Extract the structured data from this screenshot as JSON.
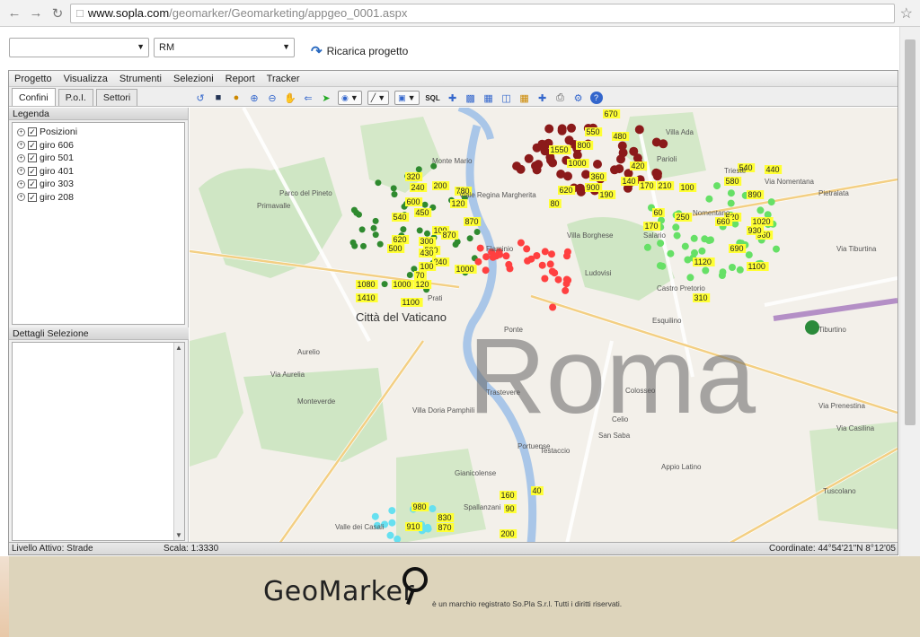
{
  "browser": {
    "url_host": "www.sopla.com",
    "url_path": "/geomarker/Geomarketing/appgeo_0001.aspx"
  },
  "controls": {
    "select1_value": "",
    "select2_value": "RM",
    "reload_label": "Ricarica progetto"
  },
  "menu": [
    "Progetto",
    "Visualizza",
    "Strumenti",
    "Selezioni",
    "Report",
    "Tracker"
  ],
  "tabs": [
    "Confini",
    "P.o.I.",
    "Settori"
  ],
  "toolbar": {
    "sql_label": "SQL"
  },
  "legend": {
    "title": "Legenda",
    "items": [
      "Posizioni",
      "giro 606",
      "giro 501",
      "giro 401",
      "giro 303",
      "giro 208"
    ]
  },
  "details": {
    "title": "Dettagli Selezione"
  },
  "status": {
    "level": "Livello Attivo: Strade",
    "scale": "Scala: 1:3330",
    "coords": "Coordinate: 44°54'21\"N 8°12'05"
  },
  "map": {
    "city_label": "Roma",
    "places": [
      {
        "text": "Città del Vaticano"
      },
      {
        "text": "Villa Borghese"
      },
      {
        "text": "Parco del Pineto"
      },
      {
        "text": "Villa Ada"
      },
      {
        "text": "Villa Doria Pamphili"
      },
      {
        "text": "Monte Mario"
      },
      {
        "text": "Prati"
      },
      {
        "text": "Trastevere"
      },
      {
        "text": "Testaccio"
      },
      {
        "text": "Monteverde"
      },
      {
        "text": "San Saba"
      },
      {
        "text": "Appio Latino"
      },
      {
        "text": "Tuscolano"
      },
      {
        "text": "Salario"
      },
      {
        "text": "Trieste"
      },
      {
        "text": "Nomentano"
      },
      {
        "text": "Tiburtino"
      },
      {
        "text": "Pietralata"
      },
      {
        "text": "Primavalle"
      },
      {
        "text": "Aurelio"
      },
      {
        "text": "Castro Pretorio"
      },
      {
        "text": "Esquilino"
      },
      {
        "text": "Ponte"
      },
      {
        "text": "Ludovisi"
      },
      {
        "text": "Parioli"
      },
      {
        "text": "Flaminio"
      },
      {
        "text": "Gianicolense"
      },
      {
        "text": "Portuense"
      },
      {
        "text": "Spallanzani"
      },
      {
        "text": "Valle dei Casali"
      },
      {
        "text": "Colosseo"
      },
      {
        "text": "Celio"
      },
      {
        "text": "Via Aurelia"
      },
      {
        "text": "Via Tiburtina"
      },
      {
        "text": "Viale Regina Margherita"
      },
      {
        "text": "Via Nomentana"
      },
      {
        "text": "Via Casilina"
      },
      {
        "text": "Via Prenestina"
      }
    ],
    "labels_yellow": [
      "670",
      "550",
      "480",
      "1550",
      "800",
      "1000",
      "360",
      "140",
      "420",
      "620",
      "190",
      "80",
      "170",
      "900",
      "210",
      "100",
      "320",
      "240",
      "200",
      "600",
      "780",
      "120",
      "450",
      "870",
      "540",
      "100",
      "620",
      "300",
      "500",
      "580",
      "240",
      "870",
      "430",
      "1000",
      "120",
      "1000",
      "70",
      "100",
      "1080",
      "1410",
      "1100",
      "540",
      "440",
      "580",
      "890",
      "620",
      "1020",
      "660",
      "960",
      "1120",
      "690",
      "1100",
      "930",
      "310",
      "160",
      "40",
      "90",
      "980",
      "830",
      "910",
      "870",
      "200",
      "250",
      "60",
      "170"
    ]
  },
  "footer": {
    "logo": "GeoMarker",
    "trademark": "è un marchio registrato So.Pla S.r.l. Tutti i diritti riservati."
  },
  "colors": {
    "giro_red": "#8b1a1a",
    "giro_green": "#2f8a2f",
    "giro_lightgreen": "#66e066",
    "giro_bright_red": "#ff4040",
    "giro_cyan": "#66e0f0",
    "label_yellow": "#ffff33"
  }
}
